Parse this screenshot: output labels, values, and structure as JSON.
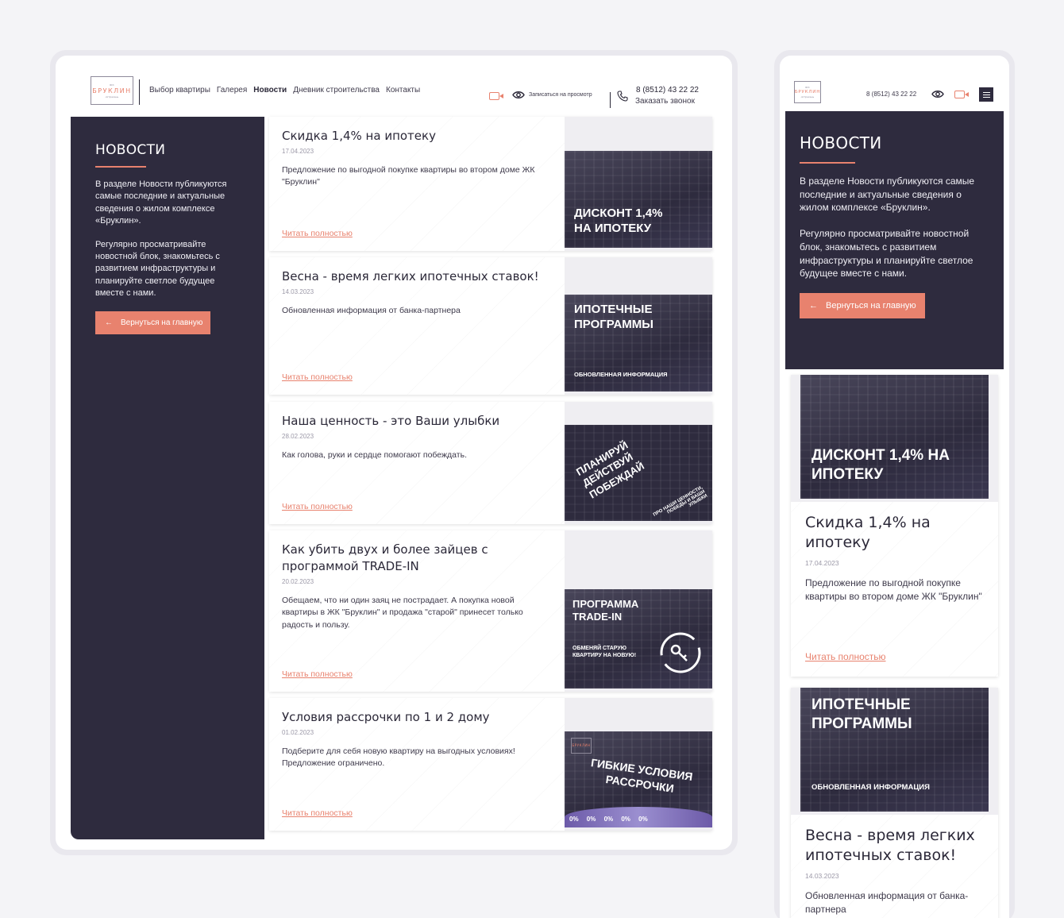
{
  "brand": {
    "top": "ЖК",
    "name": "БРУКЛИН",
    "sub": "Астрахань"
  },
  "nav": [
    {
      "label": "Выбор квартиры",
      "active": false
    },
    {
      "label": "Галерея",
      "active": false
    },
    {
      "label": "Новости",
      "active": true
    },
    {
      "label": "Дневник строительства",
      "active": false
    },
    {
      "label": "Контакты",
      "active": false
    }
  ],
  "header": {
    "view_label": "Записаться на просмотр",
    "phone": "8 (8512) 43 22 22",
    "call_label": "Заказать звонок"
  },
  "sidebar": {
    "title": "НОВОСТИ",
    "p1": "В разделе Новости публикуются самые последние и актуальные сведения о жилом комплексе «Бруклин».",
    "p2": "Регулярно просматривайте новостной блок, знакомьтесь с развитием инфраструктуры и планируйте светлое будущее вместе с нами.",
    "back_label": "Вернуться на главную"
  },
  "more_label": "Читать полностью",
  "news": [
    {
      "title": "Скидка 1,4% на ипотеку",
      "date": "17.04.2023",
      "desc": "Предложение по выгодной покупке квартиры во втором доме ЖК \"Бруклин\"",
      "banner_big": "ДИСКОНТ 1,4% НА ИПОТЕКУ",
      "banner_small": ""
    },
    {
      "title": "Весна - время легких ипотечных ставок!",
      "date": "14.03.2023",
      "desc": "Обновленная информация от банка-партнера",
      "banner_big": "ИПОТЕЧНЫЕ ПРОГРАММЫ",
      "banner_small": "ОБНОВЛЕННАЯ ИНФОРМАЦИЯ"
    },
    {
      "title": "Наша ценность - это Ваши улыбки",
      "date": "28.02.2023",
      "desc": "Как голова, руки и сердце помогают побеждать.",
      "banner_big": "ПЛАНИРУЙ ДЕЙСТВУЙ ПОБЕЖДАЙ",
      "banner_small": "ПРО НАШИ ЦЕННОСТИ, ПОБЕДЫ И ВАШИ УЛЫБКИ"
    },
    {
      "title": "Как убить двух и более зайцев с программой TRADE-IN",
      "date": "20.02.2023",
      "desc": "Обещаем, что ни один заяц не пострадает. А покупка новой квартиры в ЖК \"Бруклин\" и продажа \"старой\" принесет только радость и пользу.",
      "banner_big": "ПРОГРАММА TRADE-IN",
      "banner_small": "ОБМЕНЯЙ СТАРУЮ КВАРТИРУ НА НОВУЮ!"
    },
    {
      "title": "Условия рассрочки по 1 и 2 дому",
      "date": "01.02.2023",
      "desc": "Подберите для себя новую квартиру на выгодных условиях! Предложение ограничено.",
      "banner_big": "ГИБКИЕ УСЛОВИЯ РАССРОЧКИ",
      "banner_small": "0% 0% 0% 0% 0%"
    }
  ],
  "mobile": {
    "phone": "8 (8512) 43 22 22",
    "sidebar": {
      "title": "НОВОСТИ",
      "p1": "В разделе Новости публикуются самые последние и актуальные сведения о жилом комплексе «Бруклин».",
      "p2": "Регулярно просматривайте новостной блок, знакомьтесь с развитием инфраструктуры и планируйте светлое будущее вместе с нами.",
      "back_label": "Вернуться на главную"
    }
  },
  "colors": {
    "accent": "#e8826e",
    "dark": "#2e2b3e",
    "frame": "#e9e8ee"
  }
}
